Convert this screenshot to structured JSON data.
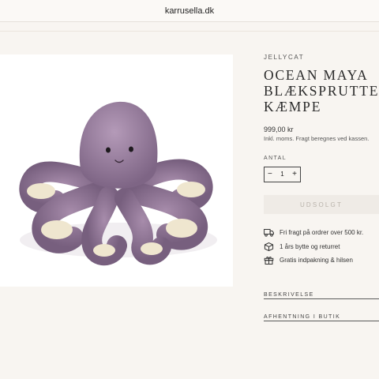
{
  "browser": {
    "url": "karrusella.dk"
  },
  "product": {
    "brand": "JELLYCAT",
    "title_lines": [
      "OCEAN MAYA",
      "BLÆKSPRUTTE,",
      "KÆMPE"
    ],
    "price": "999,00 kr",
    "tax_note": "Inkl. moms. Fragt beregnes ved kassen.",
    "quantity_label": "ANTAL",
    "quantity_value": "1",
    "minus": "−",
    "plus": "+",
    "buy_button": "UDSOLGT"
  },
  "perks": [
    {
      "icon": "truck-icon",
      "text": "Fri fragt på ordrer over 500 kr."
    },
    {
      "icon": "box-icon",
      "text": "1 års bytte og returret"
    },
    {
      "icon": "gift-icon",
      "text": "Gratis indpakning & hilsen"
    }
  ],
  "accordions": [
    {
      "label": "BESKRIVELSE"
    },
    {
      "label": "AFHENTNING I BUTIK"
    }
  ],
  "colors": {
    "background": "#f8f5f1",
    "octopus": "#9a7f9f",
    "suckers": "#efe6cf",
    "soldout_bg": "#efebe6"
  }
}
